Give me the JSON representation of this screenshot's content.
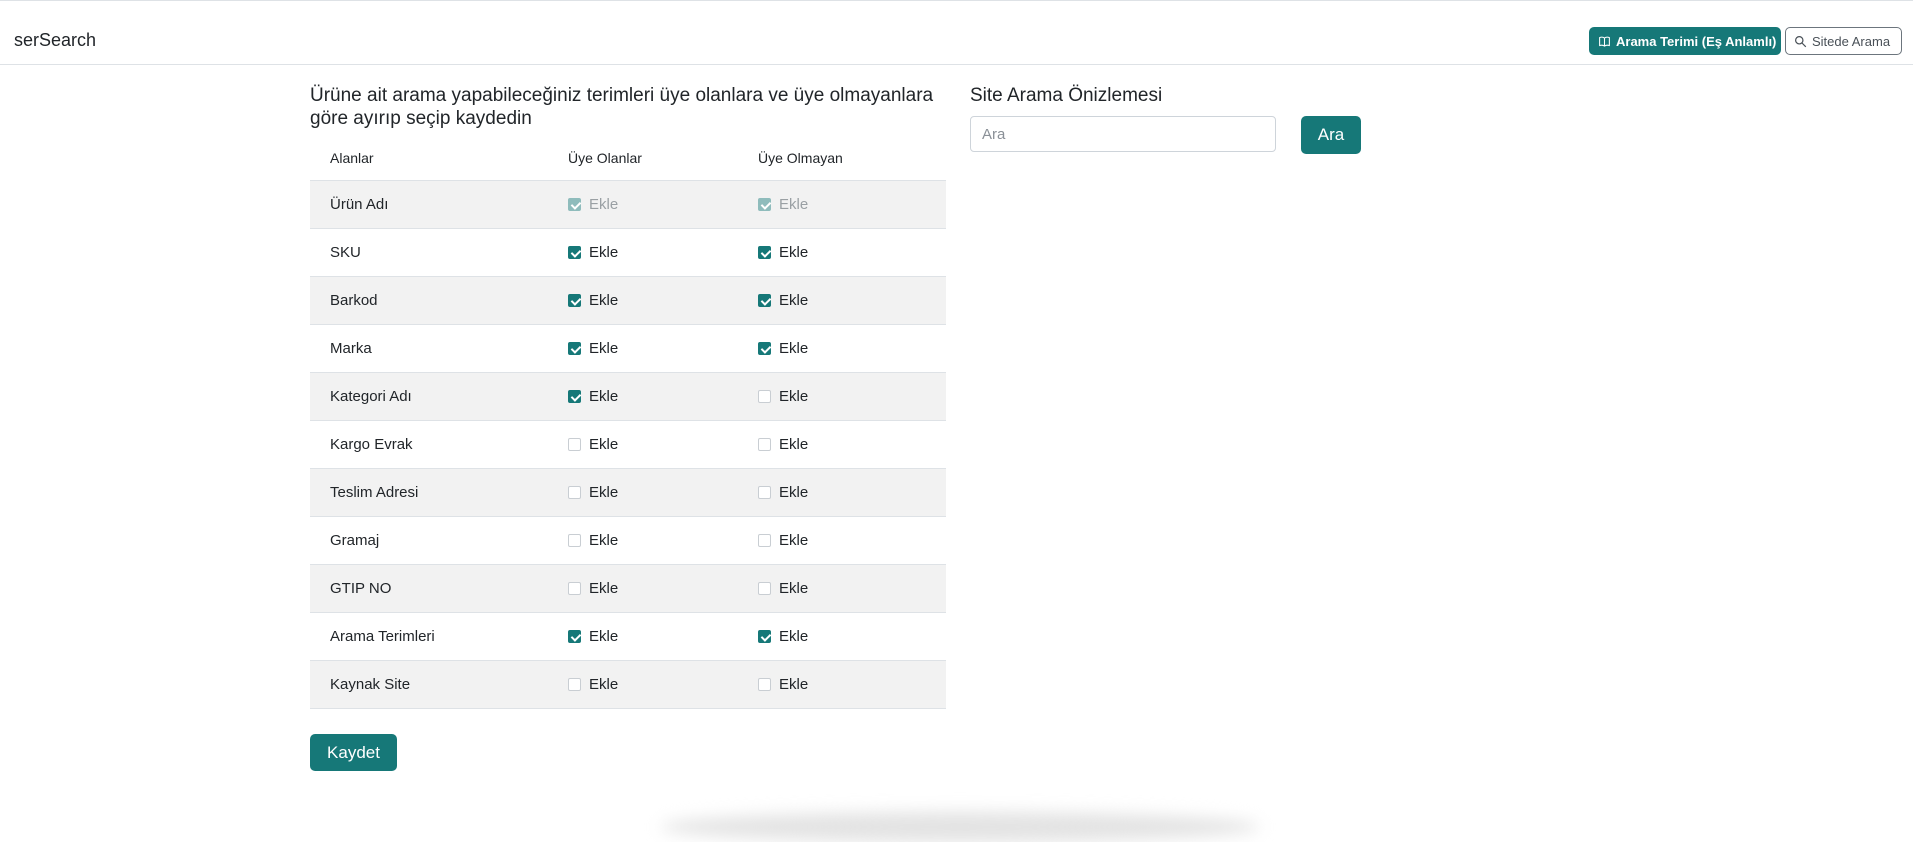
{
  "app": {
    "brand": "serSearch",
    "nav": {
      "primary_label": "Arama Terimi (Eş Anlamlı)",
      "primary_icon": "book-icon",
      "secondary_label": "Sitede Arama",
      "secondary_icon": "search-icon"
    }
  },
  "main": {
    "heading": "Ürüne ait arama yapabileceğiniz terimleri üye olanlara ve üye olmayanlara göre ayırıp seçip kaydedin",
    "columns": [
      "Alanlar",
      "Üye Olanlar",
      "Üye Olmayan"
    ],
    "check_label": "Ekle",
    "rows": [
      {
        "field": "Ürün Adı",
        "members": true,
        "non_members": true,
        "disabled": true
      },
      {
        "field": "SKU",
        "members": true,
        "non_members": true,
        "disabled": false
      },
      {
        "field": "Barkod",
        "members": true,
        "non_members": true,
        "disabled": false
      },
      {
        "field": "Marka",
        "members": true,
        "non_members": true,
        "disabled": false
      },
      {
        "field": "Kategori Adı",
        "members": true,
        "non_members": false,
        "disabled": false
      },
      {
        "field": "Kargo Evrak",
        "members": false,
        "non_members": false,
        "disabled": false
      },
      {
        "field": "Teslim Adresi",
        "members": false,
        "non_members": false,
        "disabled": false
      },
      {
        "field": "Gramaj",
        "members": false,
        "non_members": false,
        "disabled": false
      },
      {
        "field": "GTIP NO",
        "members": false,
        "non_members": false,
        "disabled": false
      },
      {
        "field": "Arama Terimleri",
        "members": true,
        "non_members": true,
        "disabled": false
      },
      {
        "field": "Kaynak Site",
        "members": false,
        "non_members": false,
        "disabled": false
      }
    ],
    "save_label": "Kaydet"
  },
  "preview": {
    "title": "Site Arama Önizlemesi",
    "search_placeholder": "Ara",
    "search_value": "",
    "search_button": "Ara"
  },
  "colors": {
    "accent": "#167878"
  }
}
